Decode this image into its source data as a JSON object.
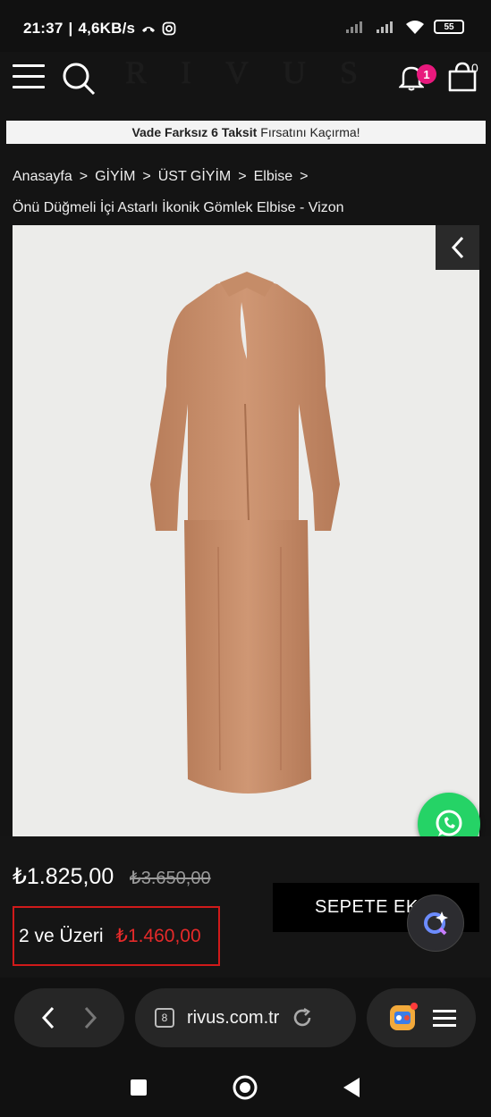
{
  "status_bar": {
    "time": "21:37",
    "speed": "4,6KB/s",
    "battery": "55"
  },
  "header": {
    "brand": "RIVUS",
    "notification_count": "1",
    "cart_count": "0"
  },
  "promo": {
    "bold_text": "Vade Farksız 6 Taksit",
    "text": "Fırsatını Kaçırma!"
  },
  "breadcrumb": {
    "items": [
      "Anasayfa",
      "GİYİM",
      "ÜST GİYİM",
      "Elbise"
    ],
    "separator": ">"
  },
  "product": {
    "title": "Önü Düğmeli İçi Astarlı İkonik Gömlek Elbise - Vizon",
    "price": "₺1.825,00",
    "old_price": "₺3.650,00",
    "bulk_label": "2 ve Üzeri",
    "bulk_price": "₺1.460,00",
    "add_to_cart": "SEPETE EKLE",
    "garment_color": "#c98f6c"
  },
  "browser": {
    "url": "rivus.com.tr",
    "tab_count": "8"
  },
  "colors": {
    "accent_red": "#d01a1a",
    "whatsapp": "#25d366",
    "badge": "#e8197d"
  }
}
